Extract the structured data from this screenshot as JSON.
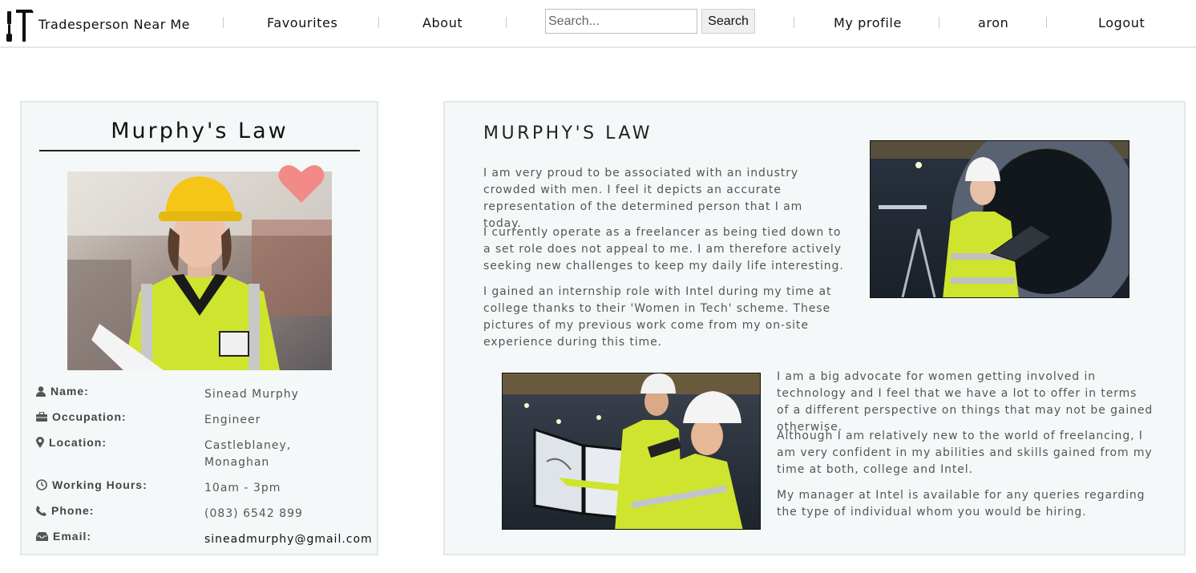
{
  "nav": {
    "brand": "Tradesperson Near Me",
    "links": [
      "Favourites",
      "About"
    ],
    "search_placeholder": "Search...",
    "search_button": "Search",
    "right_links": [
      "My profile",
      "aron",
      "Logout"
    ]
  },
  "profile": {
    "title": "Murphy's Law",
    "fields": [
      {
        "label": "Name:",
        "value": "Sinead Murphy",
        "icon": "user-icon"
      },
      {
        "label": "Occupation:",
        "value": "Engineer",
        "icon": "briefcase-icon"
      },
      {
        "label": "Location:",
        "value": "Castleblaney, Monaghan",
        "icon": "map-marker-icon"
      },
      {
        "label": "Working Hours:",
        "value": "10am - 3pm",
        "icon": "clock-icon"
      },
      {
        "label": "Phone:",
        "value": "(083) 6542 899",
        "icon": "phone-icon"
      },
      {
        "label": "Email:",
        "value": "sineadmurphy@gmail.com",
        "icon": "envelope-icon"
      }
    ]
  },
  "about": {
    "title": "MURPHY'S LAW",
    "paragraphs_top": [
      "I am very proud to be associated with an industry crowded with men. I feel it depicts an accurate representation of the determined person that I am today.",
      "I currently operate as a freelancer as being tied down to a set role does not appeal to me. I am therefore actively seeking new challenges to keep my daily life interesting.",
      "I gained an internship role with Intel during my time at college thanks to their 'Women in Tech' scheme. These pictures of my previous work come from my on-site experience during this time."
    ],
    "paragraphs_bottom": [
      "I am a big advocate for women getting involved in technology and I feel that we have a lot to offer in terms of a different perspective on things that may not be gained otherwise.",
      "Although I am relatively new to the world of freelancing, I am very confident in my abilities and skills gained from my time at both, college and Intel.",
      "My manager at Intel is available for any queries regarding the type of individual whom you would be hiring."
    ]
  },
  "colors": {
    "heart": "#f28b88",
    "card_bg": "#f5f8f9",
    "hi_vis": "#d4e82c"
  }
}
